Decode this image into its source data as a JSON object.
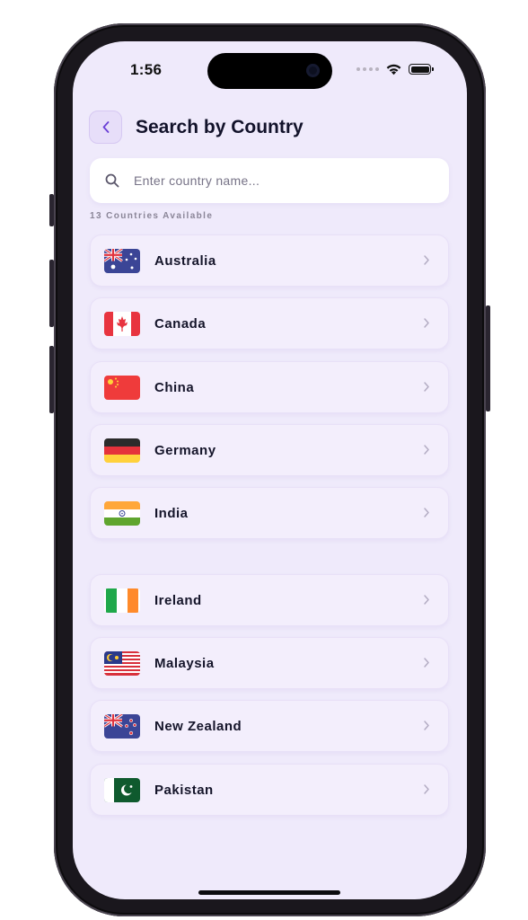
{
  "status_bar": {
    "time": "1:56"
  },
  "header": {
    "title": "Search by Country",
    "back_icon": "chevron-left-icon"
  },
  "search": {
    "placeholder": "Enter country name...",
    "value": "",
    "icon": "search-icon"
  },
  "list_info": {
    "count_label": "13 Countries Available"
  },
  "countries": [
    {
      "name": "Australia",
      "flag": "australia-flag-icon"
    },
    {
      "name": "Canada",
      "flag": "canada-flag-icon"
    },
    {
      "name": "China",
      "flag": "china-flag-icon"
    },
    {
      "name": "Germany",
      "flag": "germany-flag-icon"
    },
    {
      "name": "India",
      "flag": "india-flag-icon"
    },
    {
      "name": "Ireland",
      "flag": "ireland-flag-icon"
    },
    {
      "name": "Malaysia",
      "flag": "malaysia-flag-icon"
    },
    {
      "name": "New Zealand",
      "flag": "new-zealand-flag-icon"
    },
    {
      "name": "Pakistan",
      "flag": "pakistan-flag-icon"
    }
  ],
  "colors": {
    "background": "#efeafb",
    "accent": "#6a3fd6",
    "card": "#f3eefc",
    "title": "#12122a"
  }
}
